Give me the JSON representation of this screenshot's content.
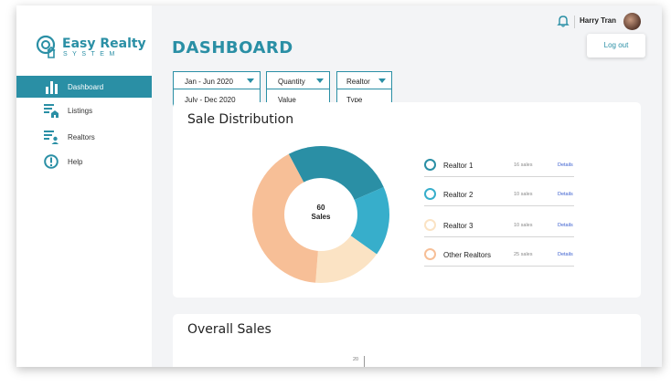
{
  "app": {
    "logo_title": "Easy Realty",
    "logo_subtitle": "SYSTEM",
    "brand_color": "#2a8fa5"
  },
  "sidebar": {
    "items": [
      {
        "label": "Dashboard",
        "icon": "bar-chart-icon",
        "active": true
      },
      {
        "label": "Listings",
        "icon": "listings-house-icon",
        "active": false
      },
      {
        "label": "Realtors",
        "icon": "realtors-person-icon",
        "active": false
      },
      {
        "label": "Help",
        "icon": "exclamation-circle-icon",
        "active": false
      }
    ]
  },
  "header": {
    "page_title": "DASHBOARD",
    "user_name": "Harry Tran",
    "logout_label": "Log out"
  },
  "filters": [
    {
      "selected": "Jan - Jun 2020",
      "option": "July - Dec 2020"
    },
    {
      "selected": "Quantity",
      "option": "Value"
    },
    {
      "selected": "Realtor",
      "option": "Type"
    }
  ],
  "sale_distribution": {
    "title": "Sale Distribution",
    "center_value": "60",
    "center_label": "Sales",
    "legend": [
      {
        "name": "Realtor 1",
        "count": "16 sales",
        "link": "Details",
        "color": "#2a8fa5"
      },
      {
        "name": "Realtor 2",
        "count": "10 sales",
        "link": "Details",
        "color": "#37aecb"
      },
      {
        "name": "Realtor 3",
        "count": "10 sales",
        "link": "Details",
        "color": "#fbe3c4"
      },
      {
        "name": "Other Realtors",
        "count": "25 sales",
        "link": "Details",
        "color": "#f7bf97"
      }
    ]
  },
  "chart_data": {
    "type": "pie",
    "categories": [
      "Realtor 1",
      "Realtor 2",
      "Realtor 3",
      "Other Realtors"
    ],
    "values": [
      16,
      10,
      10,
      25
    ],
    "colors": [
      "#2a8fa5",
      "#37aecb",
      "#fbe3c4",
      "#f7bf97"
    ],
    "title": "Sale Distribution",
    "legend": "right"
  },
  "overall_sales": {
    "title": "Overall Sales",
    "y_tick": "20"
  }
}
